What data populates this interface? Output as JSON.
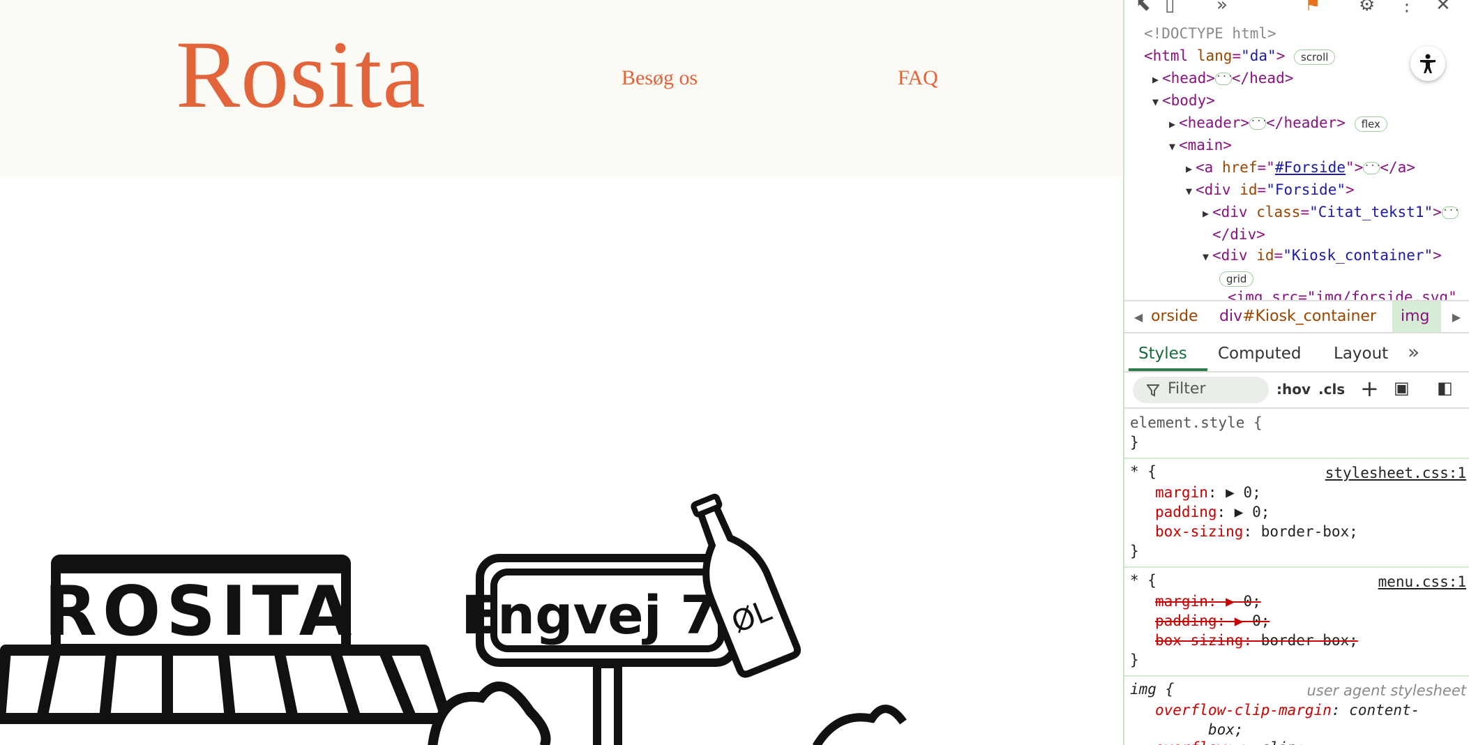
{
  "site": {
    "logo": "Rosita",
    "nav": [
      {
        "label": "Besøg os"
      },
      {
        "label": "FAQ"
      }
    ],
    "illustration": {
      "kiosk_sign": "ROSITA",
      "street_sign": "Engvej 77",
      "bottle_label": "ØL"
    },
    "accent_color": "#e2643a",
    "header_bg": "#fcfaf4"
  },
  "devtools": {
    "dom": {
      "doctype": "<!DOCTYPE html>",
      "html_tag": "<html",
      "html_attr": "lang",
      "html_val": "\"da\"",
      "html_close": ">",
      "html_badge": "scroll",
      "head_open": "<head>",
      "head_close": "</head>",
      "body_open": "<body>",
      "header_open": "<header>",
      "header_close": "</header>",
      "header_badge": "flex",
      "main_open": "<main>",
      "a_tag": "<a",
      "a_attr": "href",
      "a_val": "#Forside",
      "a_close": "</a>",
      "div_forside_tag": "<div",
      "div_forside_attr": "id",
      "div_forside_val": "\"Forside\"",
      "citat_tag": "<div",
      "citat_attr": "class",
      "citat_val": "\"Citat_tekst1\"",
      "div_close": "</div>",
      "kiosk_tag": "<div",
      "kiosk_attr": "id",
      "kiosk_val": "\"Kiosk_container\"",
      "kiosk_badge": "grid",
      "img_partial": "<img src=\"img/forside.svg\""
    },
    "breadcrumb": {
      "forside": "orside",
      "kiosk_div": "div",
      "kiosk_id": "#Kiosk_container",
      "img": "img"
    },
    "tabs": [
      "Styles",
      "Computed",
      "Layout"
    ],
    "filter": {
      "placeholder": "Filter",
      "hov": ":hov",
      "cls": ".cls"
    },
    "rules": {
      "element_style": "element.style {",
      "close_brace": "}",
      "star": "* {",
      "src1": "stylesheet.css:1",
      "src2": "menu.css:1",
      "img_sel": "img {",
      "ua": "user agent stylesheet",
      "margin": "margin",
      "padding": "padding",
      "box_sizing": "box-sizing",
      "zero": "0;",
      "border_box": "border-box;",
      "ocm": "overflow-clip-margin",
      "ocm_val1": "content-",
      "ocm_val2": "box;",
      "overflow": "overflow",
      "clip": "clip;"
    }
  }
}
